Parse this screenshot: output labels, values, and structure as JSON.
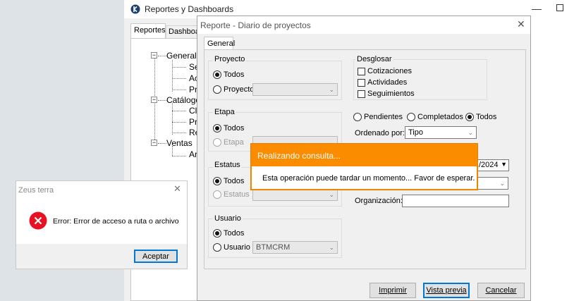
{
  "main_window": {
    "title": "Reportes y Dashboards",
    "tabs": [
      "Reportes",
      "Dashboards"
    ],
    "tree": [
      {
        "label": "Generales",
        "level": 0
      },
      {
        "label": "Se",
        "level": 1
      },
      {
        "label": "Ac",
        "level": 1
      },
      {
        "label": "Pr",
        "level": 1
      },
      {
        "label": "Catálogos",
        "level": 0
      },
      {
        "label": "Cli",
        "level": 1
      },
      {
        "label": "Pr",
        "level": 1
      },
      {
        "label": "Re",
        "level": 1
      },
      {
        "label": "Ventas",
        "level": 0
      },
      {
        "label": "Ar",
        "level": 1
      }
    ]
  },
  "report_dialog": {
    "title": "Reporte - Diario de proyectos",
    "tab": "General",
    "proyecto": {
      "label": "Proyecto",
      "opt_todos": "Todos",
      "opt_one": "Proyecto"
    },
    "etapa": {
      "label": "Etapa",
      "opt_todos": "Todos",
      "opt_one": "Etapa"
    },
    "estatus": {
      "label": "Estatus",
      "opt_todos": "Todos",
      "opt_one": "Estatus"
    },
    "usuario": {
      "label": "Usuario",
      "opt_todos": "Todos",
      "opt_one": "Usuario",
      "selected_user": "BTMCRM"
    },
    "desglosar": {
      "label": "Desglosar",
      "items": [
        "Cotizaciones",
        "Actividades",
        "Seguimientos"
      ]
    },
    "status_filter": {
      "pendientes": "Pendientes",
      "completados": "Completados",
      "todos": "Todos"
    },
    "ordenado_por": {
      "label": "Ordenado por:",
      "value": "Tipo"
    },
    "date_partial": "/2024",
    "organizacion": {
      "label": "Organización:",
      "value": ""
    },
    "buttons": {
      "imprimir": "Imprimir",
      "vista_previa": "Vista previa",
      "cancelar": "Cancelar"
    }
  },
  "progress_toast": {
    "title": "Realizando consulta...",
    "message": "Esta operación puede tardar un momento... Favor de esperar.",
    "accent": "#fb8c00"
  },
  "error_dialog": {
    "title": "Zeus terra",
    "message": "Error: Error de acceso a ruta o archivo",
    "ok_label": "Aceptar",
    "icon_color": "#e81123"
  }
}
